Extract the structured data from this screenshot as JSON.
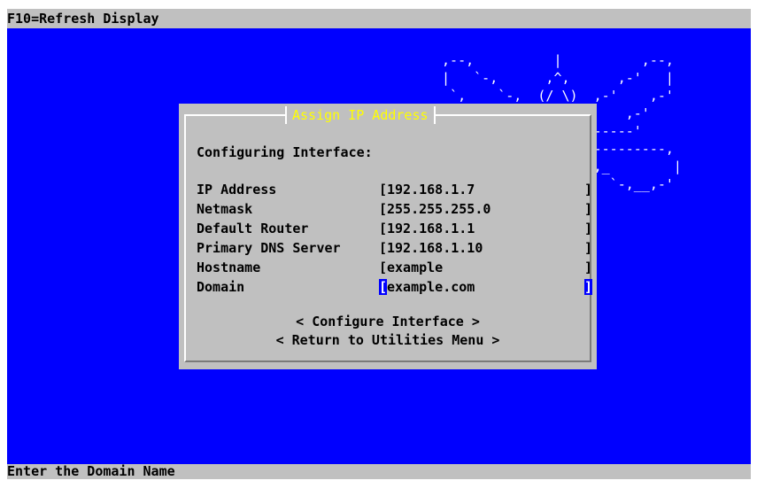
{
  "top_bar": {
    "text": "F10=Refresh Display"
  },
  "status_bar": {
    "text": "Enter the Domain Name"
  },
  "dialog": {
    "title": "Assign IP Address",
    "heading": "Configuring Interface:",
    "fields": [
      {
        "label": "IP Address",
        "value": "192.168.1.7"
      },
      {
        "label": "Netmask",
        "value": "255.255.255.0"
      },
      {
        "label": "Default Router",
        "value": "192.168.1.1"
      },
      {
        "label": "Primary DNS Server",
        "value": "192.168.1.10"
      },
      {
        "label": "Hostname",
        "value": "example"
      },
      {
        "label": "Domain",
        "value": "example.com"
      }
    ],
    "buttons": {
      "configure": "< Configure Interface >",
      "return": "< Return to Utilities Menu >"
    }
  },
  "colors": {
    "background": "#0000ff",
    "dialog": "#c0c0c0",
    "title": "#ffff00",
    "cursor": "#0000ff"
  }
}
